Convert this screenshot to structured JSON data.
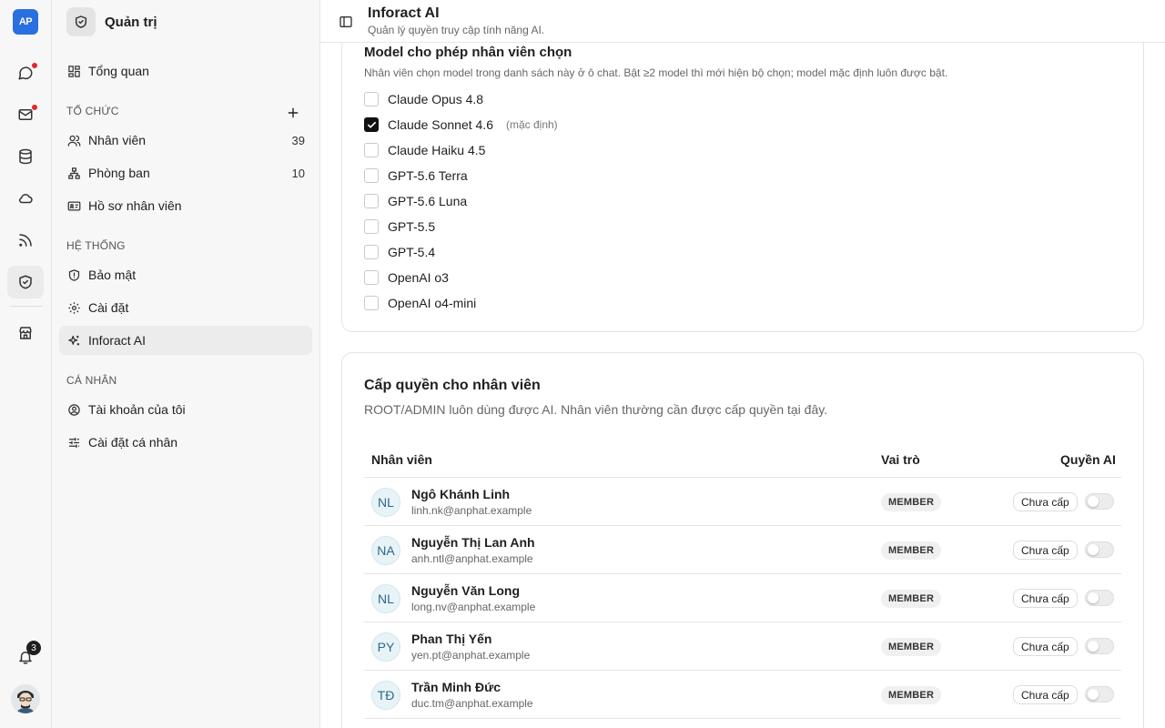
{
  "rail": {
    "logo": "AP",
    "notif_count": "3"
  },
  "sidebar": {
    "title": "Quản trị",
    "overview": "Tổng quan",
    "sections": {
      "org": "TỔ CHỨC",
      "system": "HỆ THỐNG",
      "personal": "CÁ NHÂN"
    },
    "org_items": [
      {
        "label": "Nhân viên",
        "count": "39"
      },
      {
        "label": "Phòng ban",
        "count": "10"
      },
      {
        "label": "Hồ sơ nhân viên"
      }
    ],
    "system_items": [
      {
        "label": "Bảo mật"
      },
      {
        "label": "Cài đặt"
      },
      {
        "label": "Inforact AI"
      }
    ],
    "personal_items": [
      {
        "label": "Tài khoản của tôi"
      },
      {
        "label": "Cài đặt cá nhân"
      }
    ]
  },
  "header": {
    "title": "Inforact AI",
    "subtitle": "Quản lý quyền truy cập tính năng AI."
  },
  "models_card": {
    "title": "Model cho phép nhân viên chọn",
    "subtitle": "Nhân viên chọn model trong danh sách này ở ô chat. Bật ≥2 model thì mới hiện bộ chọn; model mặc định luôn được bật.",
    "default_tag": "(mặc định)",
    "models": [
      {
        "name": "Claude Opus 4.8",
        "checked": false
      },
      {
        "name": "Claude Sonnet 4.6",
        "checked": true
      },
      {
        "name": "Claude Haiku 4.5",
        "checked": false
      },
      {
        "name": "GPT-5.6 Terra",
        "checked": false
      },
      {
        "name": "GPT-5.6 Luna",
        "checked": false
      },
      {
        "name": "GPT-5.5",
        "checked": false
      },
      {
        "name": "GPT-5.4",
        "checked": false
      },
      {
        "name": "OpenAI o3",
        "checked": false
      },
      {
        "name": "OpenAI o4-mini",
        "checked": false
      }
    ]
  },
  "permissions_card": {
    "title": "Cấp quyền cho nhân viên",
    "subtitle": "ROOT/ADMIN luôn dùng được AI. Nhân viên thường cần được cấp quyền tại đây.",
    "columns": {
      "employee": "Nhân viên",
      "role": "Vai trò",
      "ai_permission": "Quyền AI"
    },
    "employees": [
      {
        "initials": "NL",
        "name": "Ngô Khánh Linh",
        "email": "linh.nk@anphat.example",
        "role": "MEMBER",
        "status": "Chưa cấp"
      },
      {
        "initials": "NA",
        "name": "Nguyễn Thị Lan Anh",
        "email": "anh.ntl@anphat.example",
        "role": "MEMBER",
        "status": "Chưa cấp"
      },
      {
        "initials": "NL",
        "name": "Nguyễn Văn Long",
        "email": "long.nv@anphat.example",
        "role": "MEMBER",
        "status": "Chưa cấp"
      },
      {
        "initials": "PY",
        "name": "Phan Thị Yến",
        "email": "yen.pt@anphat.example",
        "role": "MEMBER",
        "status": "Chưa cấp"
      },
      {
        "initials": "TĐ",
        "name": "Trần Minh Đức",
        "email": "duc.tm@anphat.example",
        "role": "MEMBER",
        "status": "Chưa cấp"
      }
    ]
  },
  "colors": {
    "accent": "#2a6fe0",
    "notification_dot": "#e5252a",
    "checkbox_checked": "#111111"
  }
}
